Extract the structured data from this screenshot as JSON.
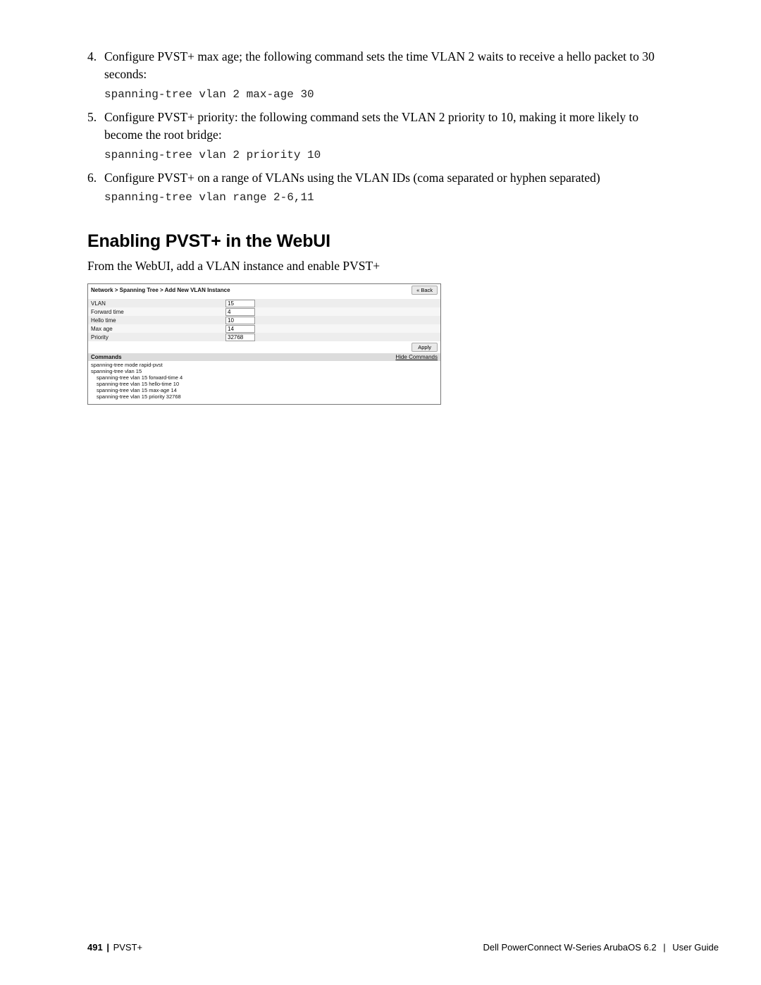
{
  "steps": {
    "s4": {
      "num": "4.",
      "text": "Configure PVST+ max age; the following command sets the time VLAN 2 waits to receive a hello packet to 30 seconds:",
      "code": "spanning-tree vlan 2 max-age 30"
    },
    "s5": {
      "num": "5.",
      "text": "Configure PVST+ priority: the following command sets the VLAN 2 priority to 10, making it more likely to become the root bridge:",
      "code": "spanning-tree vlan 2 priority 10"
    },
    "s6": {
      "num": "6.",
      "text": "Configure PVST+ on a range of VLANs using the VLAN IDs (coma separated or hyphen separated)",
      "code": "spanning-tree vlan range 2-6,11"
    }
  },
  "section": {
    "heading": "Enabling PVST+ in the WebUI",
    "intro": "From the WebUI, add a VLAN instance and enable PVST+"
  },
  "webui": {
    "breadcrumb": "Network > Spanning Tree > Add New VLAN Instance",
    "back_label": "« Back",
    "rows": {
      "vlan": {
        "label": "VLAN",
        "value": "15"
      },
      "fwd": {
        "label": "Forward time",
        "value": "4"
      },
      "hello": {
        "label": "Hello time",
        "value": "10"
      },
      "max": {
        "label": "Max age",
        "value": "14"
      },
      "prio": {
        "label": "Priority",
        "value": "32768"
      }
    },
    "apply_label": "Apply",
    "commands_title": "Commands",
    "hide_commands": "Hide Commands",
    "commands": {
      "c1": "spanning-tree mode rapid-pvst",
      "c2": "spanning-tree vlan 15",
      "c3": "spanning-tree vlan 15 forward-time 4",
      "c4": "spanning-tree vlan 15 hello-time 10",
      "c5": "spanning-tree vlan 15 max-age 14",
      "c6": "spanning-tree vlan 15 priority 32768"
    }
  },
  "footer": {
    "page_no": "491",
    "sep": "|",
    "section": "PVST+",
    "product": "Dell PowerConnect W-Series ArubaOS 6.2",
    "sep2": "|",
    "doc": "User Guide"
  }
}
